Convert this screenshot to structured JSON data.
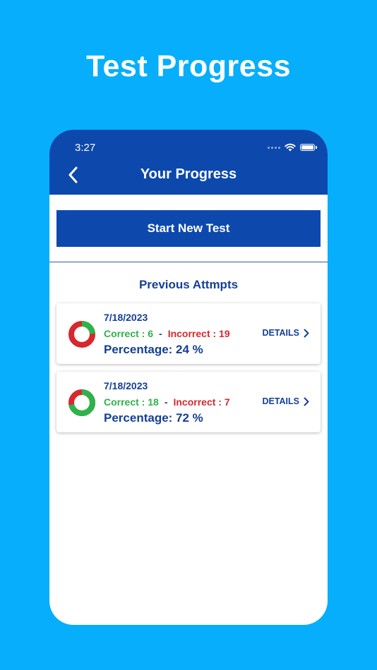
{
  "promo": {
    "title": "Test Progress"
  },
  "status_bar": {
    "time": "3:27"
  },
  "header": {
    "title": "Your Progress",
    "back_icon": "chevron-left-icon"
  },
  "actions": {
    "start_new_test": "Start New Test"
  },
  "section": {
    "title": "Previous Attmpts"
  },
  "attempts": [
    {
      "date": "7/18/2023",
      "correct_label": "Correct : 6",
      "separator": "-",
      "incorrect_label": "Incorrect : 19",
      "percentage_label": "Percentage: 24 %",
      "correct_fraction": 0.24,
      "details_label": "DETAILS"
    },
    {
      "date": "7/18/2023",
      "correct_label": "Correct : 18",
      "separator": "-",
      "incorrect_label": "Incorrect : 7",
      "percentage_label": "Percentage: 72 %",
      "correct_fraction": 0.72,
      "details_label": "DETAILS"
    }
  ],
  "colors": {
    "background": "#06AEFB",
    "primary": "#0D49AD",
    "text_primary": "#143F96",
    "correct": "#2DB34A",
    "incorrect": "#D8272D"
  }
}
